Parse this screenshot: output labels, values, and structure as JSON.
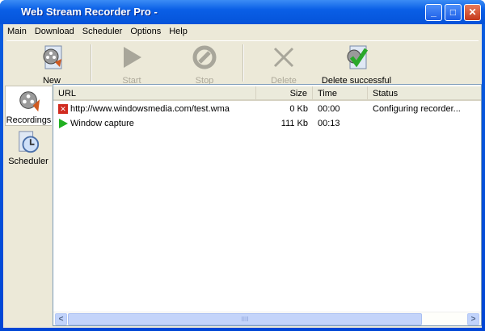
{
  "window": {
    "title": "Web Stream Recorder Pro -",
    "minimize": "_",
    "maximize": "□",
    "close": "✕"
  },
  "menu": [
    "Main",
    "Download",
    "Scheduler",
    "Options",
    "Help"
  ],
  "toolbar": {
    "new": "New",
    "start": "Start",
    "stop": "Stop",
    "delete": "Delete",
    "delete_successful": "Delete successful"
  },
  "sidebar": {
    "recordings": "Recordings",
    "scheduler": "Scheduler"
  },
  "list": {
    "columns": [
      "URL",
      "Size",
      "Time",
      "Status"
    ],
    "rows": [
      {
        "icon": "error-icon",
        "url": "http://www.windowsmedia.com/test.wma",
        "size": "0 Kb",
        "time": "00:00",
        "status": "Configuring recorder..."
      },
      {
        "icon": "play-icon",
        "url": "Window capture",
        "size": "111 Kb",
        "time": "00:13",
        "status": ""
      }
    ]
  },
  "scrollbar": {
    "left": "<",
    "right": ">",
    "grip": "IIII"
  }
}
